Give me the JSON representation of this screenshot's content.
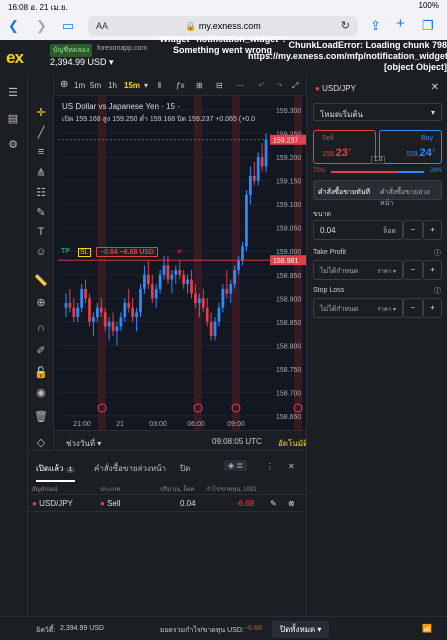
{
  "status": {
    "time": "16:08",
    "date": "อ. 21 เม.ย.",
    "battery": "100%"
  },
  "browser": {
    "aa": "AA",
    "url": "my.exness.com"
  },
  "header": {
    "logo": "ex",
    "demo_badge": "บัญชีทดลอง",
    "account_site": "forexonapp.com",
    "balance": "2,394.99 USD",
    "error_widget": "Widget \"notification_widget\": Something went wrong",
    "error_chunk": "ChunkLoadError: Loading chunk 798 https://my.exness.com/mfp/notification_widget [object Object]"
  },
  "toolbar": {
    "timeframes": [
      "1m",
      "5m",
      "1h",
      "15m"
    ],
    "active_tf": "15m"
  },
  "chart": {
    "title": "US Dollar vs Japanese Yen · 15 ·",
    "ohlc": "เปิด 159.168  สูง 159.250  ต่ำ 159.168  ปิด 159.237  +0.065 (+0.0",
    "current_price_label": "159.237",
    "order_line_price": "158.981",
    "order_tp": "TP",
    "order_sl": "SL",
    "order_pl": "−0.04   −6.68 USD",
    "order_close": "×",
    "time_labels": [
      "21:00",
      "21",
      "03:00",
      "06:00",
      "09:00"
    ],
    "range_label": "ช่วงวันที่",
    "clock": "09:08:05 UTC",
    "auto_label": "อัตโนมัติ"
  },
  "chart_data": {
    "type": "candlestick",
    "title": "US Dollar vs Japanese Yen · 15",
    "ylim": [
      158.62,
      159.33
    ],
    "yticks": [
      "159.300",
      "159.250",
      "159.200",
      "159.150",
      "159.100",
      "159.050",
      "159.000",
      "158.950",
      "158.900",
      "158.850",
      "158.800",
      "158.750",
      "158.700",
      "158.650"
    ],
    "xticks": [
      "21:00",
      "21",
      "03:00",
      "06:00",
      "09:00"
    ],
    "candles": [
      [
        158.88,
        158.91,
        158.86,
        158.89
      ],
      [
        158.89,
        158.92,
        158.87,
        158.88
      ],
      [
        158.88,
        158.9,
        158.85,
        158.86
      ],
      [
        158.86,
        158.89,
        158.85,
        158.88
      ],
      [
        158.88,
        158.93,
        158.87,
        158.92
      ],
      [
        158.92,
        158.94,
        158.89,
        158.9
      ],
      [
        158.9,
        158.91,
        158.84,
        158.85
      ],
      [
        158.85,
        158.87,
        158.82,
        158.86
      ],
      [
        158.86,
        158.89,
        158.85,
        158.88
      ],
      [
        158.88,
        158.9,
        158.86,
        158.87
      ],
      [
        158.87,
        158.88,
        158.83,
        158.84
      ],
      [
        158.84,
        158.86,
        158.81,
        158.85
      ],
      [
        158.85,
        158.87,
        158.82,
        158.83
      ],
      [
        158.83,
        158.85,
        158.8,
        158.84
      ],
      [
        158.84,
        158.87,
        158.83,
        158.86
      ],
      [
        158.86,
        158.9,
        158.85,
        158.89
      ],
      [
        158.89,
        158.92,
        158.87,
        158.88
      ],
      [
        158.88,
        158.9,
        158.85,
        158.86
      ],
      [
        158.86,
        158.88,
        158.83,
        158.87
      ],
      [
        158.87,
        158.93,
        158.86,
        158.92
      ],
      [
        158.92,
        158.97,
        158.91,
        158.95
      ],
      [
        158.95,
        158.98,
        158.92,
        158.93
      ],
      [
        158.93,
        158.95,
        158.89,
        158.9
      ],
      [
        158.9,
        158.93,
        158.88,
        158.92
      ],
      [
        158.92,
        158.96,
        158.91,
        158.95
      ],
      [
        158.95,
        158.99,
        158.94,
        158.97
      ],
      [
        158.97,
        158.99,
        158.93,
        158.94
      ],
      [
        158.94,
        158.96,
        158.91,
        158.95
      ],
      [
        158.95,
        158.97,
        158.93,
        158.96
      ],
      [
        158.96,
        158.98,
        158.94,
        158.95
      ],
      [
        158.95,
        158.96,
        158.92,
        158.93
      ],
      [
        158.93,
        158.95,
        158.91,
        158.94
      ],
      [
        158.94,
        158.96,
        158.9,
        158.91
      ],
      [
        158.91,
        158.93,
        158.88,
        158.89
      ],
      [
        158.89,
        158.91,
        158.86,
        158.9
      ],
      [
        158.9,
        158.92,
        158.87,
        158.88
      ],
      [
        158.88,
        158.9,
        158.84,
        158.85
      ],
      [
        158.85,
        158.87,
        158.81,
        158.82
      ],
      [
        158.82,
        158.86,
        158.81,
        158.85
      ],
      [
        158.85,
        158.89,
        158.84,
        158.88
      ],
      [
        158.88,
        158.93,
        158.87,
        158.92
      ],
      [
        158.92,
        158.96,
        158.9,
        158.91
      ],
      [
        158.91,
        158.94,
        158.89,
        158.93
      ],
      [
        158.93,
        158.97,
        158.92,
        158.96
      ],
      [
        158.96,
        158.99,
        158.95,
        158.98
      ],
      [
        158.98,
        159.02,
        158.97,
        159.01
      ],
      [
        159.01,
        159.13,
        159.0,
        159.12
      ],
      [
        159.12,
        159.18,
        159.1,
        159.16
      ],
      [
        159.16,
        159.19,
        159.14,
        159.15
      ],
      [
        159.15,
        159.21,
        159.14,
        159.2
      ],
      [
        159.2,
        159.23,
        159.17,
        159.18
      ],
      [
        159.18,
        159.25,
        159.168,
        159.237
      ]
    ]
  },
  "sidebar_icons": [
    "menu-icon",
    "wallet-icon",
    "settings-icon"
  ],
  "trade_panel": {
    "symbol": "USD/JPY",
    "mode": "โหมดเริ่มต้น",
    "sell_label": "Sell",
    "sell_price_main": "159.23",
    "sell_price_big": "23",
    "sell_price_sup": "7",
    "sell_prefix": "159.",
    "buy_label": "Buy",
    "buy_prefix": "159.",
    "buy_price_big": "24",
    "buy_price_sup": "7",
    "spread": "1.0",
    "sentiment_sell": "72%",
    "sentiment_buy": "28%",
    "sentiment_sell_fraction": 0.72,
    "market_order": "คำสั่งซื้อขายทันที",
    "pending_order": "คำสั่งซื้อขายล่วงหน้า",
    "volume_label": "ขนาด",
    "volume_value": "0.04",
    "volume_unit": "ล็อต",
    "tp_label": "Take Profit",
    "tp_value": "ไม่ได้กำหนด",
    "tp_unit": "ราคา",
    "sl_label": "Stop Loss",
    "sl_value": "ไม่ได้กำหนด",
    "sl_unit": "ราคา",
    "minus": "−",
    "plus": "+"
  },
  "orders_panel": {
    "tabs": [
      "เปิดแล้ว",
      "คำสั่งซื้อขายล่วงหน้า",
      "ปิด"
    ],
    "open_count": "1",
    "headers": [
      "สัญลักษณ์",
      "ประเภท",
      "ปริมาณ, ล็อต",
      "กำไร/ขาดทุน, USD"
    ],
    "row": {
      "symbol": "USD/JPY",
      "type": "Sell",
      "volume": "0.04",
      "pl": "-6.68"
    }
  },
  "footer": {
    "equity_label": "อิควิตี้:",
    "equity": "2,394.99 USD",
    "total_pl_label": "ยอดรวมกำไร/ขาดทุน USD:",
    "total_pl": "−6.68",
    "close_all": "ปิดทั้งหมด"
  }
}
